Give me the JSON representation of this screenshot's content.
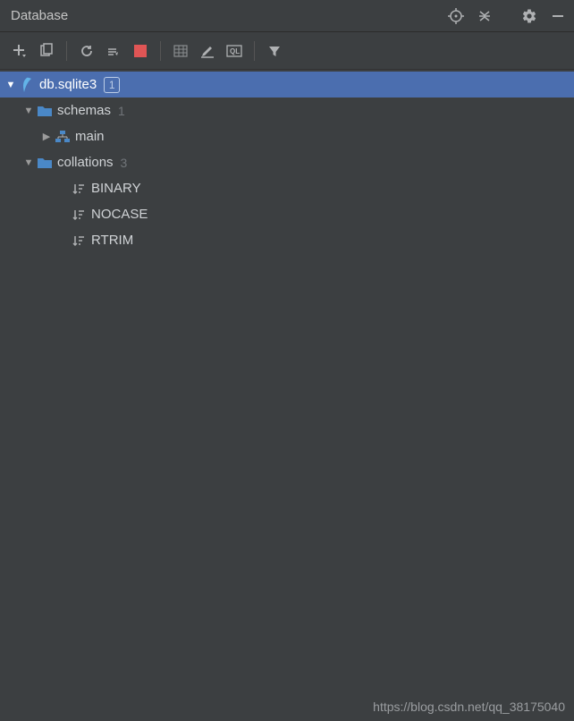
{
  "header": {
    "title": "Database"
  },
  "tree": {
    "root": {
      "label": "db.sqlite3",
      "badge": "1"
    },
    "schemas": {
      "label": "schemas",
      "count": "1",
      "children": {
        "main": {
          "label": "main"
        }
      }
    },
    "collations": {
      "label": "collations",
      "count": "3",
      "items": [
        {
          "label": "BINARY"
        },
        {
          "label": "NOCASE"
        },
        {
          "label": "RTRIM"
        }
      ]
    }
  },
  "watermark": "https://blog.csdn.net/qq_38175040"
}
